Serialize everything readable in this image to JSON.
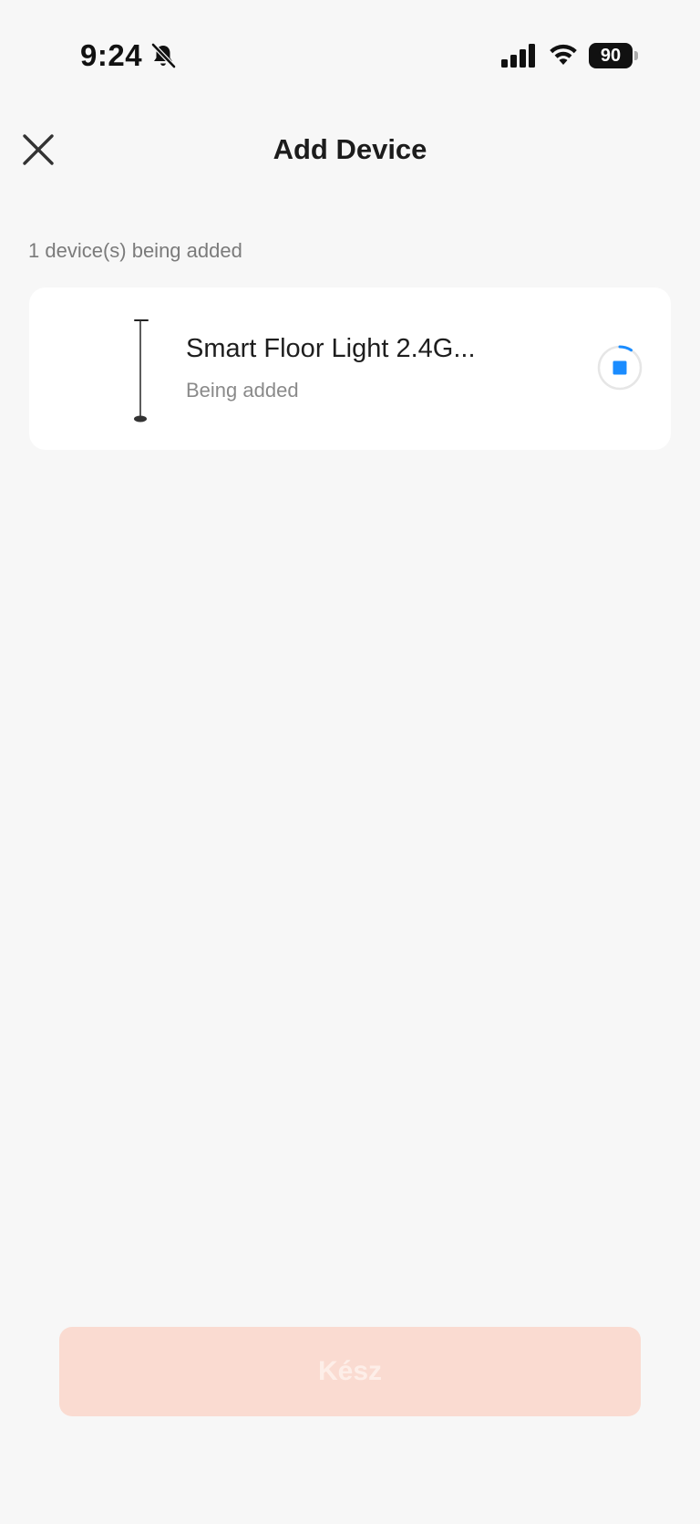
{
  "status_bar": {
    "time": "9:24",
    "battery": "90",
    "icons": [
      "bell-muted-icon",
      "signal-icon",
      "wifi-icon",
      "battery-icon"
    ]
  },
  "header": {
    "title": "Add Device",
    "close_icon": "close-icon"
  },
  "device_count_text": "1 device(s) being added",
  "devices": [
    {
      "name": "Smart Floor Light 2.4G...",
      "status": "Being added",
      "icon": "floor-lamp-icon"
    }
  ],
  "done_button": {
    "label": "Kész"
  },
  "colors": {
    "background": "#f7f7f7",
    "card": "#ffffff",
    "accent": "#1a8cff",
    "done_button_bg": "#fadbd1",
    "done_button_text": "#fdeee8"
  }
}
